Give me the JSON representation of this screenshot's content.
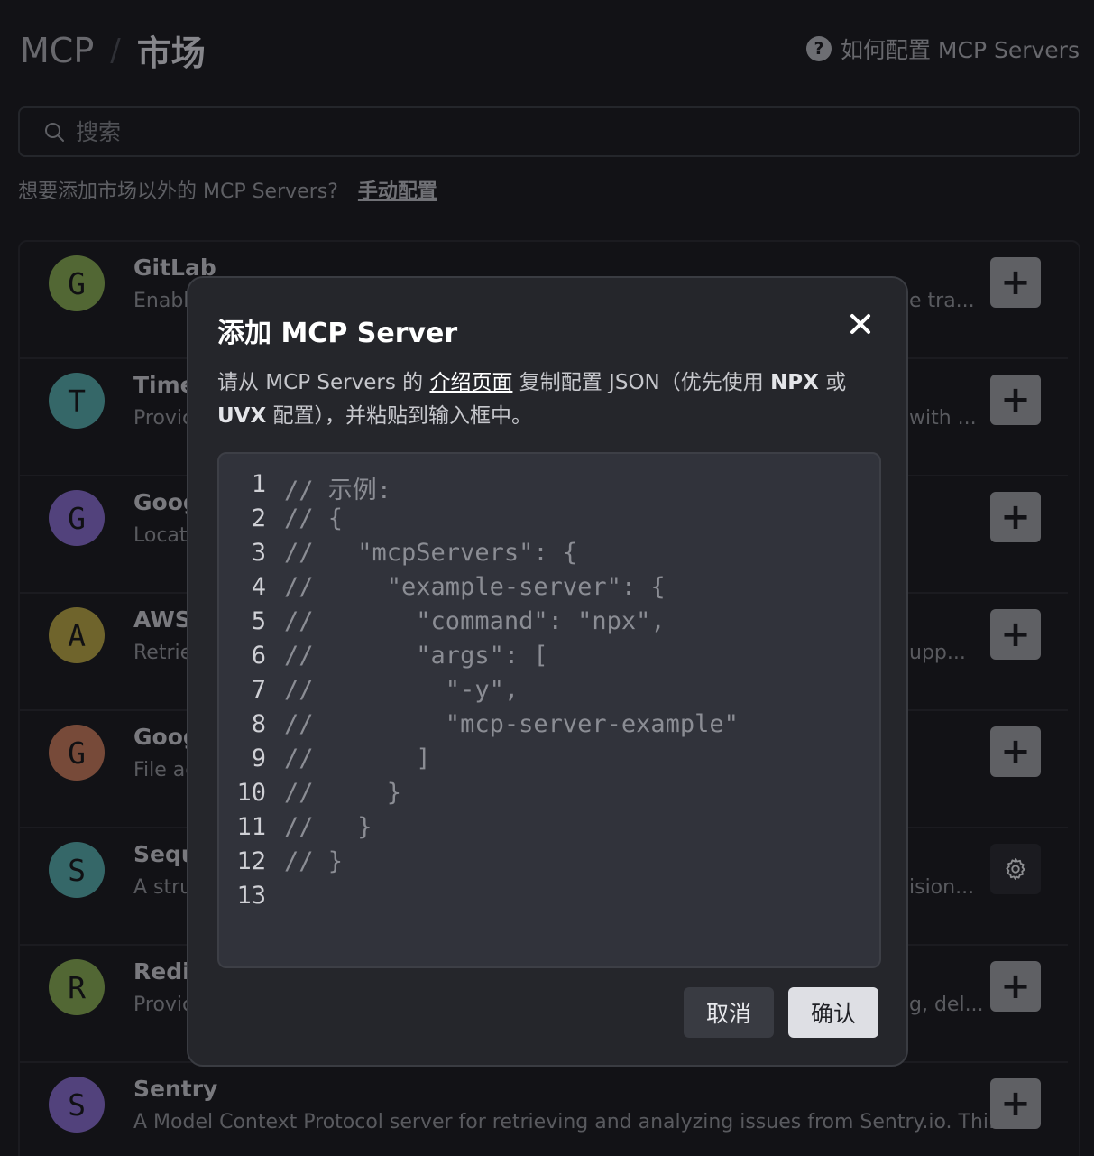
{
  "header": {
    "breadcrumb_root": "MCP",
    "breadcrumb_sep": "/",
    "breadcrumb_current": "市场",
    "help_icon_glyph": "?",
    "help_link": "如何配置 MCP Servers"
  },
  "search": {
    "placeholder": "搜索",
    "value": ""
  },
  "manual": {
    "prompt": "想要添加市场以外的 MCP Servers?",
    "link": "手动配置"
  },
  "servers": [
    {
      "letter": "G",
      "name": "GitLab",
      "desc": "Enabl",
      "tail": "e tra...",
      "color": "#7a9a4a",
      "action": "add"
    },
    {
      "letter": "T",
      "name": "Time",
      "desc": "Provic",
      "tail": "with ...",
      "color": "#4d9a9a",
      "action": "add"
    },
    {
      "letter": "G",
      "name": "Goog",
      "desc": "Locati",
      "tail": "",
      "color": "#7a62b8",
      "action": "add"
    },
    {
      "letter": "A",
      "name": "AWS",
      "desc": "Retrie",
      "tail": "upp...",
      "color": "#a6963e",
      "action": "add"
    },
    {
      "letter": "G",
      "name": "Goog",
      "desc": "File ac",
      "tail": "",
      "color": "#b26e52",
      "action": "add"
    },
    {
      "letter": "S",
      "name": "Sequ",
      "desc": "A stru",
      "tail": "ision...",
      "color": "#4d9a9a",
      "action": "settings"
    },
    {
      "letter": "R",
      "name": "Redis",
      "desc": "Provic",
      "tail": "g, del...",
      "color": "#7a9a4a",
      "action": "add"
    },
    {
      "letter": "S",
      "name": "Sentry",
      "desc": "A Model Context Protocol server for retrieving and analyzing issues from Sentry.io. Thi...",
      "tail": "",
      "color": "#7a62b8",
      "action": "add"
    }
  ],
  "action_glyph": "+",
  "modal": {
    "title": "添加 MCP Server",
    "instr_1": "请从 MCP Servers 的 ",
    "instr_link": "介绍页面",
    "instr_2": " 复制配置 JSON（优先使用 ",
    "instr_npx": "NPX",
    "instr_3": " 或",
    "instr_uvx": "UVX",
    "instr_4": " 配置），并粘贴到输入框中。",
    "cancel_label": "取消",
    "confirm_label": "确认",
    "code_lines": [
      {
        "n": "1",
        "text": "// 示例:"
      },
      {
        "n": "2",
        "text": "// {"
      },
      {
        "n": "3",
        "text": "//   \"mcpServers\": {"
      },
      {
        "n": "4",
        "text": "//     \"example-server\": {"
      },
      {
        "n": "5",
        "text": "//       \"command\": \"npx\","
      },
      {
        "n": "6",
        "text": "//       \"args\": ["
      },
      {
        "n": "7",
        "text": "//         \"-y\","
      },
      {
        "n": "8",
        "text": "//         \"mcp-server-example\""
      },
      {
        "n": "9",
        "text": "//       ]"
      },
      {
        "n": "10",
        "text": "//     }"
      },
      {
        "n": "11",
        "text": "//   }"
      },
      {
        "n": "12",
        "text": "// }"
      },
      {
        "n": "13",
        "text": ""
      }
    ]
  }
}
